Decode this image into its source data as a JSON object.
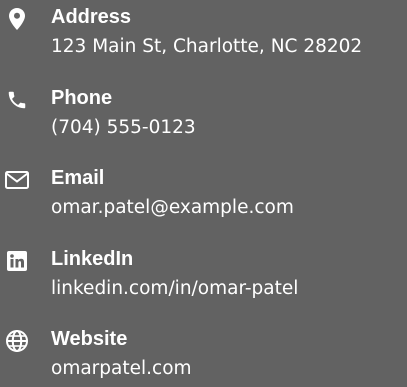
{
  "colors": {
    "background": "#626262",
    "text": "#ffffff",
    "icon": "#ffffff"
  },
  "contacts": [
    {
      "icon": "map-pin-icon",
      "label": "Address",
      "value": "123 Main St, Charlotte, NC 28202"
    },
    {
      "icon": "phone-icon",
      "label": "Phone",
      "value": "(704) 555-0123"
    },
    {
      "icon": "envelope-icon",
      "label": "Email",
      "value": "omar.patel@example.com"
    },
    {
      "icon": "linkedin-icon",
      "label": "LinkedIn",
      "value": "linkedin.com/in/omar-patel"
    },
    {
      "icon": "globe-icon",
      "label": "Website",
      "value": "omarpatel.com"
    }
  ]
}
